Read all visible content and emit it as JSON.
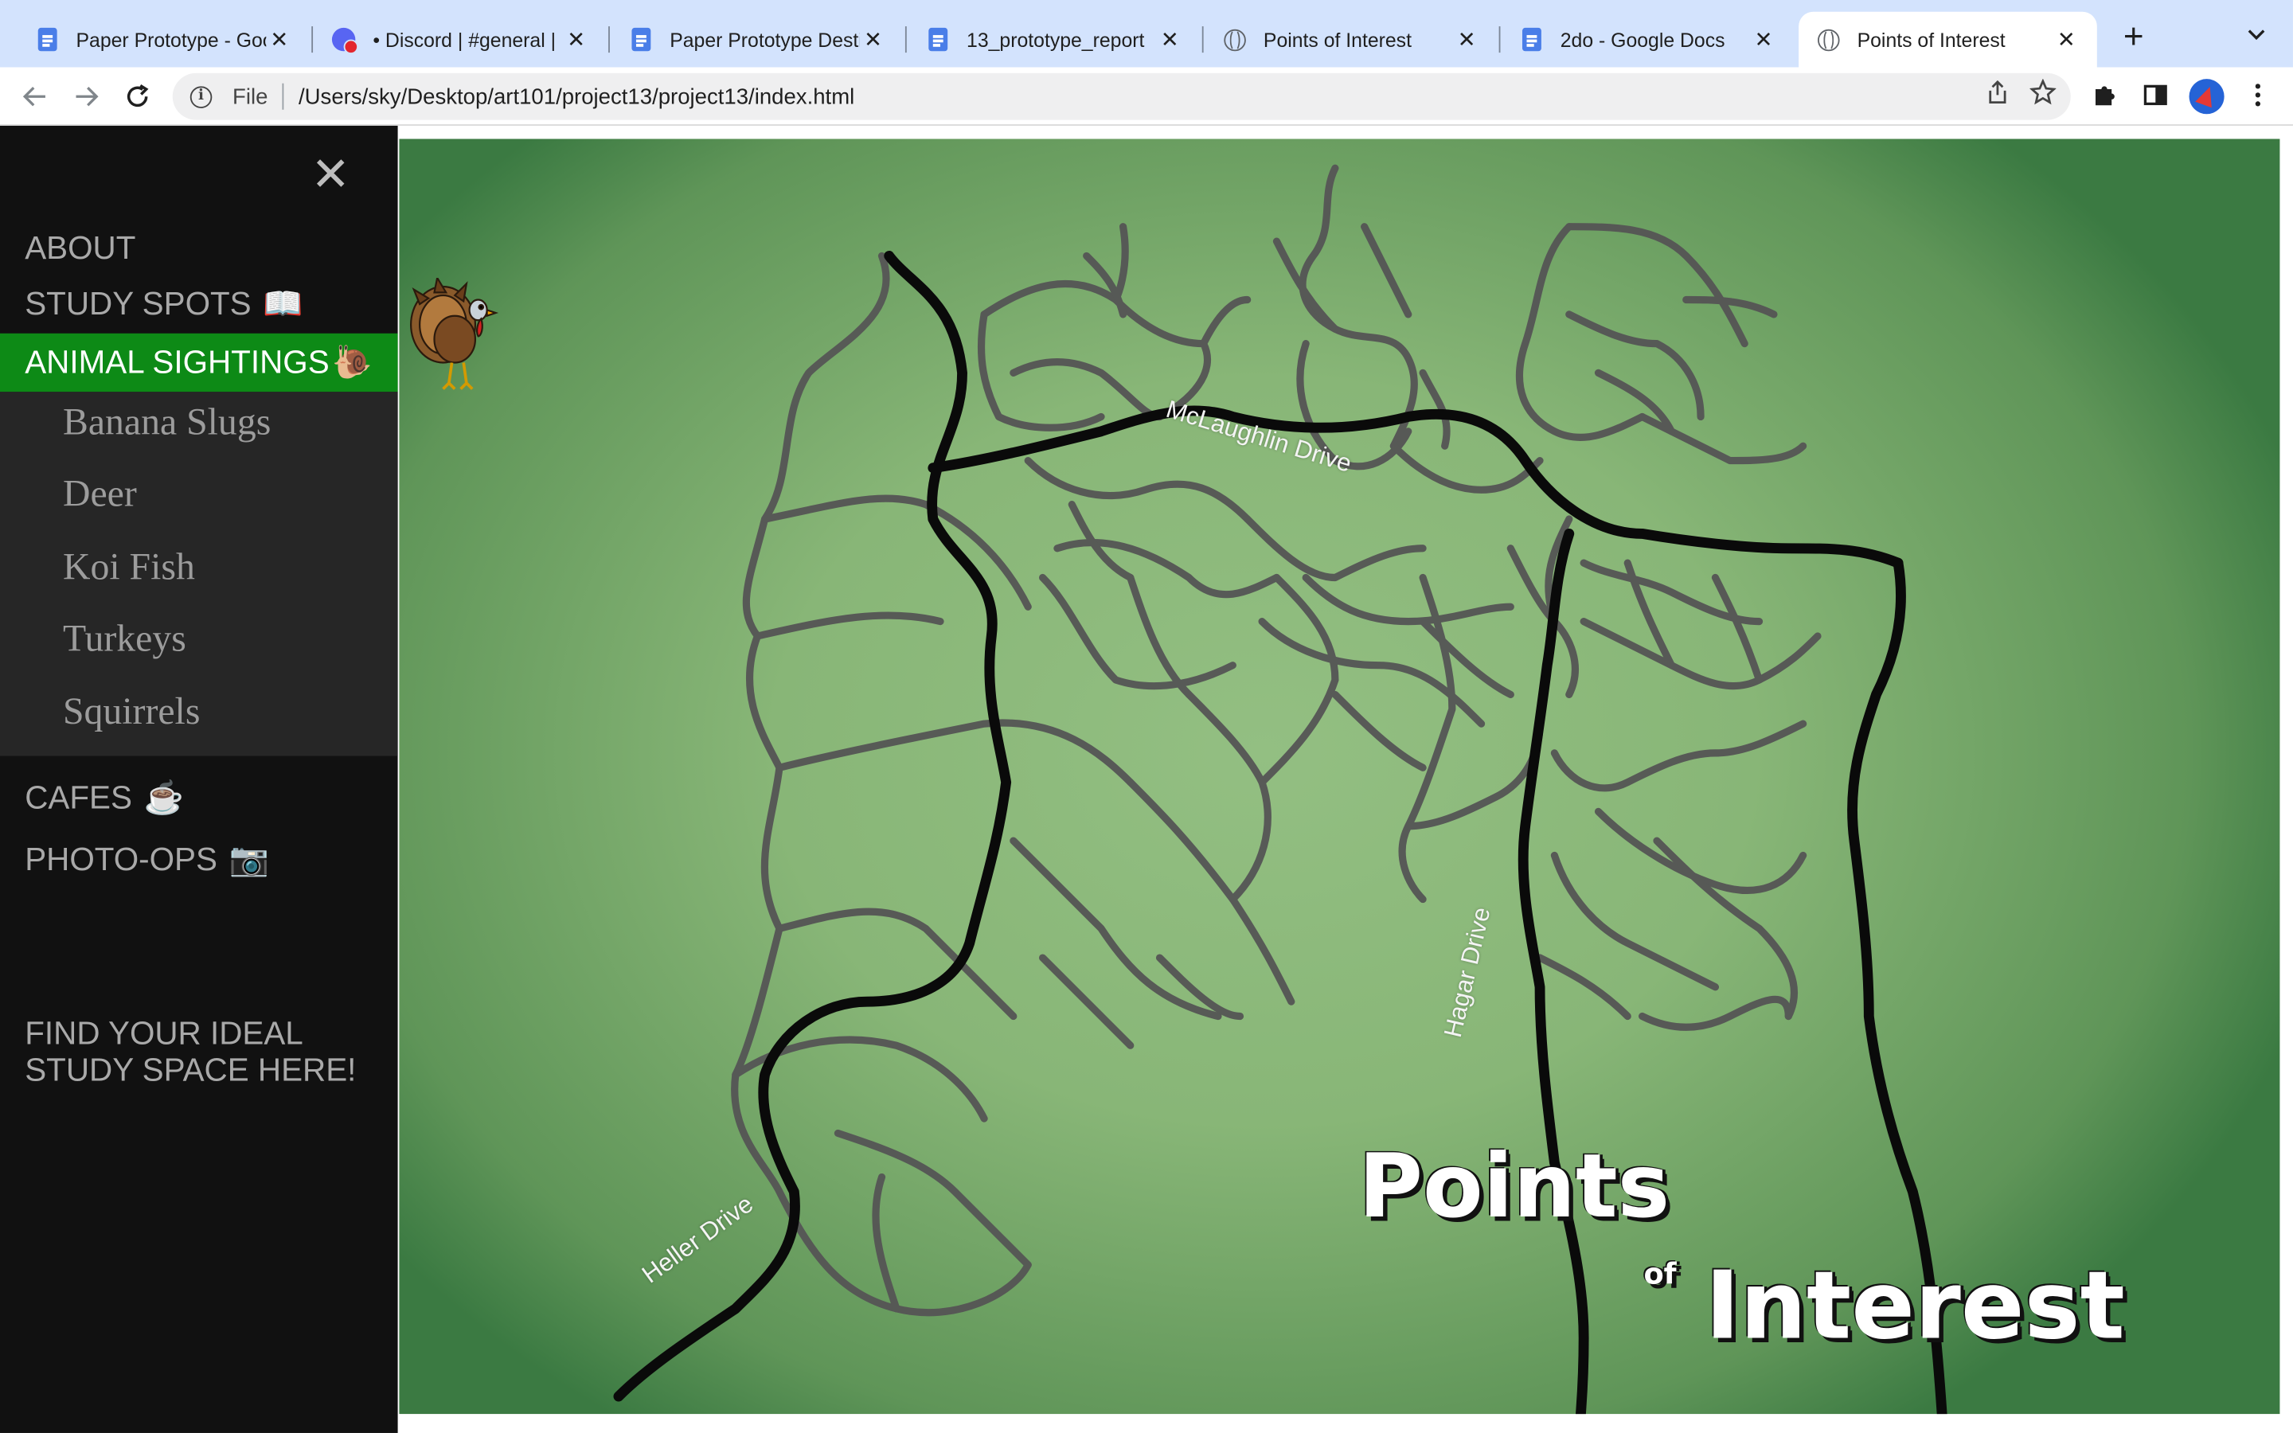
{
  "browser": {
    "tabs": [
      {
        "title": "Paper Prototype - Goo",
        "icon": "google-docs-icon"
      },
      {
        "title": "• Discord | #general |",
        "icon": "discord-icon"
      },
      {
        "title": "Paper Prototype Desti",
        "icon": "google-docs-icon"
      },
      {
        "title": "13_prototype_report",
        "icon": "google-docs-icon"
      },
      {
        "title": "Points of Interest",
        "icon": "globe-icon"
      },
      {
        "title": "2do - Google Docs",
        "icon": "google-docs-icon"
      },
      {
        "title": "Points of Interest",
        "icon": "globe-icon",
        "active": true
      }
    ],
    "address": {
      "scheme": "File",
      "url": "/Users/sky/Desktop/art101/project13/project13/index.html"
    }
  },
  "sidebar": {
    "close_glyph": "✕",
    "items": [
      {
        "label": "ABOUT",
        "emoji": ""
      },
      {
        "label": "STUDY SPOTS",
        "emoji": "📖"
      },
      {
        "label": "ANIMAL SIGHTINGS",
        "emoji": "🐌",
        "active": true
      },
      {
        "label": "CAFES",
        "emoji": "☕"
      },
      {
        "label": "PHOTO-OPS",
        "emoji": "📷"
      }
    ],
    "submenu": [
      "Banana Slugs",
      "Deer",
      "Koi Fish",
      "Turkeys",
      "Squirrels"
    ],
    "tagline": "FIND YOUR IDEAL STUDY SPACE HERE!"
  },
  "map": {
    "roads": {
      "mclaughlin": "McLaughlin Drive",
      "hagar": "Hagar Drive",
      "heller": "Heller Drive"
    },
    "title": {
      "line1": "Points",
      "of": "of",
      "line2": "Interest"
    }
  }
}
